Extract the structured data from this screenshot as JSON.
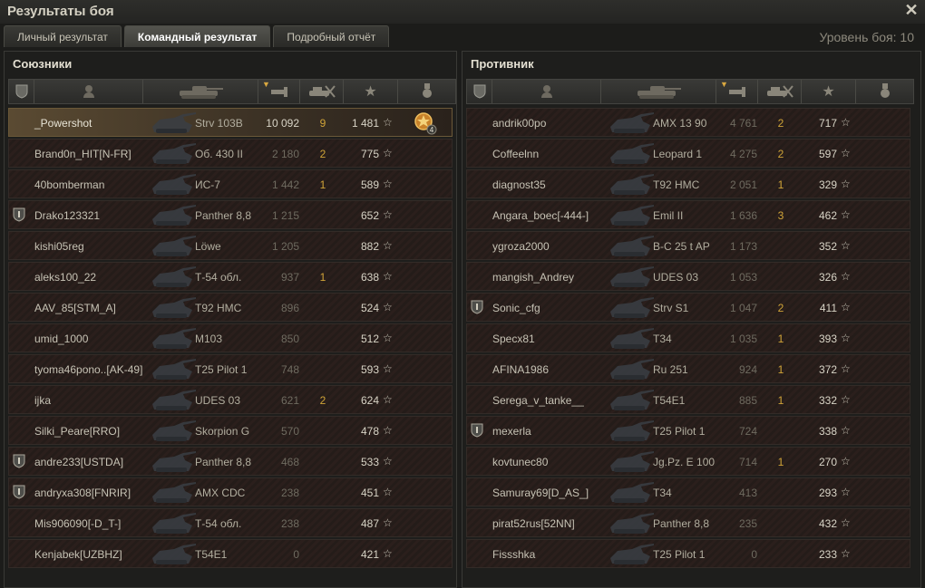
{
  "window": {
    "title": "Результаты боя",
    "close_icon": "close-icon"
  },
  "tabs": [
    {
      "label": "Личный результат",
      "active": false
    },
    {
      "label": "Командный результат",
      "active": true
    },
    {
      "label": "Подробный отчёт",
      "active": false
    }
  ],
  "battle_level": "Уровень боя: 10",
  "allies": {
    "title": "Союзники",
    "columns": [
      "clan-icon",
      "player-icon",
      "tank-icon",
      "damage-icon",
      "kills-icon",
      "xp-star-icon",
      "medal-icon"
    ],
    "rows": [
      {
        "name": "_Powershot",
        "vehicle": "Strv 103B",
        "damage": "10 092",
        "kills": "9",
        "xp": "1 481",
        "clan": false,
        "medal": "4",
        "me": true
      },
      {
        "name": "Brand0n_HIT[N-FR]",
        "vehicle": "Об. 430 II",
        "damage": "2 180",
        "kills": "2",
        "xp": "775",
        "clan": false
      },
      {
        "name": "40bomberman",
        "vehicle": "ИС-7",
        "damage": "1 442",
        "kills": "1",
        "xp": "589",
        "clan": false
      },
      {
        "name": "Drako123321",
        "vehicle": "Panther 8,8",
        "damage": "1 215",
        "kills": "",
        "xp": "652",
        "clan": true
      },
      {
        "name": "kishi05reg",
        "vehicle": "Löwe",
        "damage": "1 205",
        "kills": "",
        "xp": "882",
        "clan": false
      },
      {
        "name": "aleks100_22",
        "vehicle": "Т-54 обл.",
        "damage": "937",
        "kills": "1",
        "xp": "638",
        "clan": false
      },
      {
        "name": "AAV_85[STM_A]",
        "vehicle": "T92 HMC",
        "damage": "896",
        "kills": "",
        "xp": "524",
        "clan": false
      },
      {
        "name": "umid_1000",
        "vehicle": "M103",
        "damage": "850",
        "kills": "",
        "xp": "512",
        "clan": false
      },
      {
        "name": "tyoma46pono..[AK-49]",
        "vehicle": "T25 Pilot 1",
        "damage": "748",
        "kills": "",
        "xp": "593",
        "clan": false
      },
      {
        "name": "ijka",
        "vehicle": "UDES 03",
        "damage": "621",
        "kills": "2",
        "xp": "624",
        "clan": false
      },
      {
        "name": "Silki_Peare[RRO]",
        "vehicle": "Skorpion G",
        "damage": "570",
        "kills": "",
        "xp": "478",
        "clan": false
      },
      {
        "name": "andre233[USTDA]",
        "vehicle": "Panther 8,8",
        "damage": "468",
        "kills": "",
        "xp": "533",
        "clan": true
      },
      {
        "name": "andryxa308[FNRIR]",
        "vehicle": "AMX CDC",
        "damage": "238",
        "kills": "",
        "xp": "451",
        "clan": true
      },
      {
        "name": "Mis906090[-D_T-]",
        "vehicle": "Т-54 обл.",
        "damage": "238",
        "kills": "",
        "xp": "487",
        "clan": false
      },
      {
        "name": "Kenjabek[UZBHZ]",
        "vehicle": "T54E1",
        "damage": "0",
        "kills": "",
        "xp": "421",
        "clan": false
      }
    ]
  },
  "enemies": {
    "title": "Противник",
    "columns": [
      "clan-icon",
      "player-icon",
      "tank-icon",
      "damage-icon",
      "kills-icon",
      "xp-star-icon",
      "medal-icon"
    ],
    "rows": [
      {
        "name": "andrik00po",
        "vehicle": "AMX 13 90",
        "damage": "4 761",
        "kills": "2",
        "xp": "717",
        "clan": false
      },
      {
        "name": "Coffeelnn",
        "vehicle": "Leopard 1",
        "damage": "4 275",
        "kills": "2",
        "xp": "597",
        "clan": false
      },
      {
        "name": "diagnost35",
        "vehicle": "T92 HMC",
        "damage": "2 051",
        "kills": "1",
        "xp": "329",
        "clan": false
      },
      {
        "name": "Angara_boec[-444-]",
        "vehicle": "Emil II",
        "damage": "1 636",
        "kills": "3",
        "xp": "462",
        "clan": false
      },
      {
        "name": "ygroza2000",
        "vehicle": "B-C 25 t AP",
        "damage": "1 173",
        "kills": "",
        "xp": "352",
        "clan": false
      },
      {
        "name": "mangish_Andrey",
        "vehicle": "UDES 03",
        "damage": "1 053",
        "kills": "",
        "xp": "326",
        "clan": false
      },
      {
        "name": "Sonic_cfg",
        "vehicle": "Strv S1",
        "damage": "1 047",
        "kills": "2",
        "xp": "411",
        "clan": true
      },
      {
        "name": "Specx81",
        "vehicle": "T34",
        "damage": "1 035",
        "kills": "1",
        "xp": "393",
        "clan": false
      },
      {
        "name": "AFINA1986",
        "vehicle": "Ru 251",
        "damage": "924",
        "kills": "1",
        "xp": "372",
        "clan": false
      },
      {
        "name": "Serega_v_tanke__",
        "vehicle": "T54E1",
        "damage": "885",
        "kills": "1",
        "xp": "332",
        "clan": false
      },
      {
        "name": "mexerla",
        "vehicle": "T25 Pilot 1",
        "damage": "724",
        "kills": "",
        "xp": "338",
        "clan": true
      },
      {
        "name": "kovtunec80",
        "vehicle": "Jg.Pz. E 100",
        "damage": "714",
        "kills": "1",
        "xp": "270",
        "clan": false
      },
      {
        "name": "Samuray69[D_AS_]",
        "vehicle": "T34",
        "damage": "413",
        "kills": "",
        "xp": "293",
        "clan": false
      },
      {
        "name": "pirat52rus[52NN]",
        "vehicle": "Panther 8,8",
        "damage": "235",
        "kills": "",
        "xp": "432",
        "clan": false
      },
      {
        "name": "Fissshka",
        "vehicle": "T25 Pilot 1",
        "damage": "0",
        "kills": "",
        "xp": "233",
        "clan": false
      }
    ]
  },
  "colors": {
    "kills": "#d0a438",
    "accent": "#d9a840",
    "background": "#1c1c1a"
  }
}
